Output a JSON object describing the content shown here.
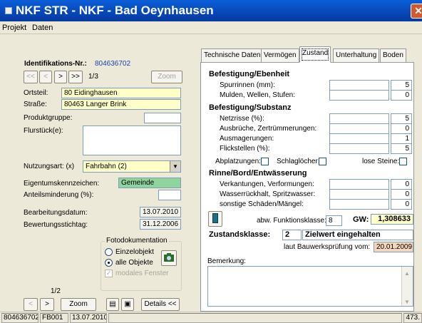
{
  "window": {
    "title": "NKF STR - NKF - Bad Oeynhausen",
    "close_glyph": "✕"
  },
  "menu": [
    "Projekt",
    "Daten"
  ],
  "left": {
    "ident_label": "Identifikations-Nr.:",
    "ident_value": "804636702",
    "nav": {
      "first": "<<",
      "prev": "<",
      "next": ">",
      "last": ">>"
    },
    "record_counter": "1/3",
    "zoom_label": "Zoom",
    "ortsteil_label": "Ortsteil:",
    "ortsteil_value": "80  Eidinghausen",
    "strasse_label": "Straße:",
    "strasse_value": "80463  Langer Brink",
    "produktgruppe_label": "Produktgruppe:",
    "produktgruppe_value": "",
    "flurstueck_label": "Flurstück(e):",
    "flurstueck_value": "",
    "nutzungsart_label": "Nutzungsart: (x)",
    "nutzungsart_value": "Fahrbahn   (2)",
    "eigentum_label": "Eigentumskennzeichen:",
    "eigentum_value": "Gemeinde",
    "anteil_label": "Anteilsminderung (%):",
    "anteil_value": "",
    "bearbeitung_label": "Bearbeitungsdatum:",
    "bearbeitung_value": "13.07.2010",
    "bewertung_label": "Bewertungsstichtag:",
    "bewertung_value": "31.12.2006",
    "foto": {
      "title": "Fotodokumentation",
      "einzelobjekt": "Einzelobjekt",
      "alle_objekte": "alle Objekte",
      "modales": "modales Fenster",
      "selected": "alle Objekte"
    },
    "pager": "1/2",
    "bottom": {
      "prev": "<",
      "next": ">",
      "zoom": "Zoom",
      "details": "Details <<"
    }
  },
  "tabs": [
    {
      "label": "Technische Daten",
      "active": false
    },
    {
      "label": "Vermögen",
      "active": false
    },
    {
      "label": "Zustand",
      "active": true
    },
    {
      "label": "Unterhaltung",
      "active": false
    },
    {
      "label": "Boden",
      "active": false
    }
  ],
  "zustand": {
    "befestigung_ebenheit": "Befestigung/Ebenheit",
    "spurrinnen_label": "Spurrinnen (mm):",
    "spurrinnen_value": "5",
    "mulden_label": "Mulden, Wellen, Stufen:",
    "mulden_value": "0",
    "befestigung_substanz": "Befestigung/Substanz",
    "netzrisse_label": "Netzrisse (%):",
    "netzrisse_value": "5",
    "ausbrueche_label": "Ausbrüche, Zertrümmerungen:",
    "ausbrueche_value": "0",
    "ausmagerungen_label": "Ausmagerungen:",
    "ausmagerungen_value": "1",
    "flickstellen_label": "Flickstellen (%):",
    "flickstellen_value": "5",
    "abplatzungen_label": "Abplatzungen:",
    "schlagloecher_label": "Schlaglöcher:",
    "lose_steine_label": "lose Steine:",
    "rinne_bord": "Rinne/Bord/Entwässerung",
    "verkantungen_label": "Verkantungen, Verformungen:",
    "verkantungen_value": "0",
    "wasser_label": "Wasserrückhalt, Spritzwasser:",
    "wasser_value": "0",
    "sonstige_label": "sonstige Schäden/Mängel:",
    "sonstige_value": "0",
    "abw_label": "abw. Funktionsklasse:",
    "abw_value": "8",
    "gw_label": "GW:",
    "gw_value": "1,308633",
    "zustandsklasse_label": "Zustandsklasse:",
    "zustandsklasse_value": "2",
    "zustandsklasse_text": "Zielwert eingehalten",
    "pruefung_label": "laut Bauwerksprüfung vom:",
    "pruefung_value": "20.01.2009",
    "bemerkung_label": "Bemerkung:",
    "bemerkung_value": ""
  },
  "status": {
    "id": "804636702",
    "code": "FB001",
    "date": "13.07.2010",
    "right": "473."
  },
  "colors": {
    "title_bar": "#0747b8",
    "yellow_field": "#ffffc8",
    "green_field": "#8fd49c",
    "close_button": "#d5572c"
  }
}
